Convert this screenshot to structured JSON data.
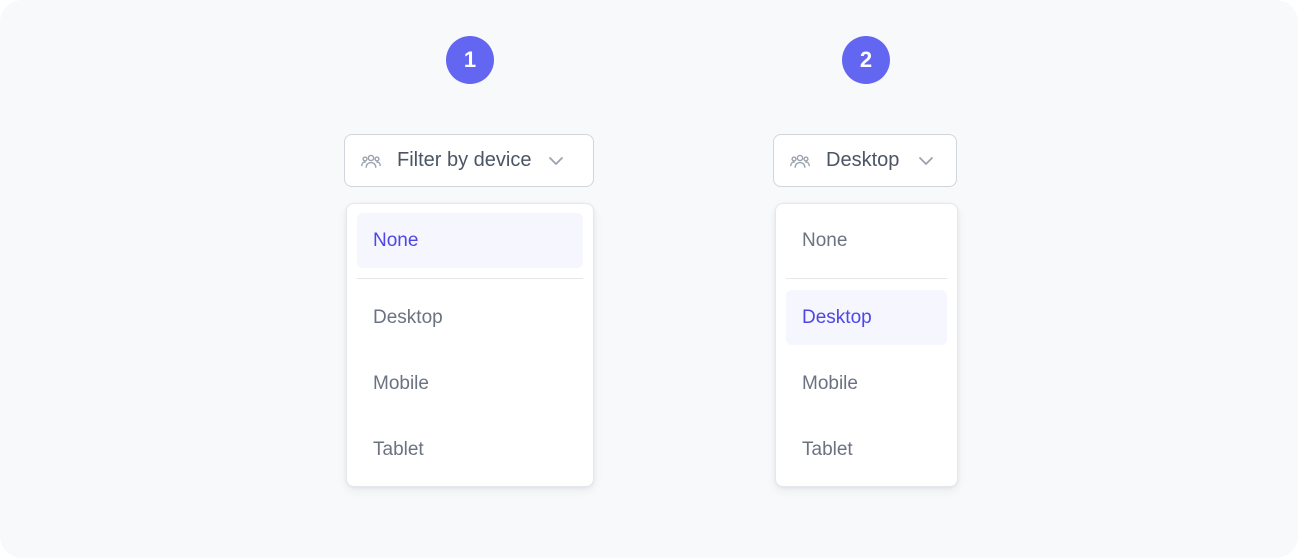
{
  "colors": {
    "accent": "#6366f1",
    "active_text": "#4f46e5",
    "active_bg": "#f5f6fe",
    "text": "#4b5563",
    "muted_text": "#6b7280",
    "background": "#f8f9fb"
  },
  "steps": [
    {
      "number": "1",
      "select": {
        "label": "Filter by device",
        "icon": "users-icon",
        "chevron": "chevron-down-icon"
      },
      "menu": {
        "items": [
          "None",
          "Desktop",
          "Mobile",
          "Tablet"
        ],
        "selected": "None"
      }
    },
    {
      "number": "2",
      "select": {
        "label": "Desktop",
        "icon": "users-icon",
        "chevron": "chevron-down-icon"
      },
      "menu": {
        "items": [
          "None",
          "Desktop",
          "Mobile",
          "Tablet"
        ],
        "selected": "Desktop"
      }
    }
  ]
}
